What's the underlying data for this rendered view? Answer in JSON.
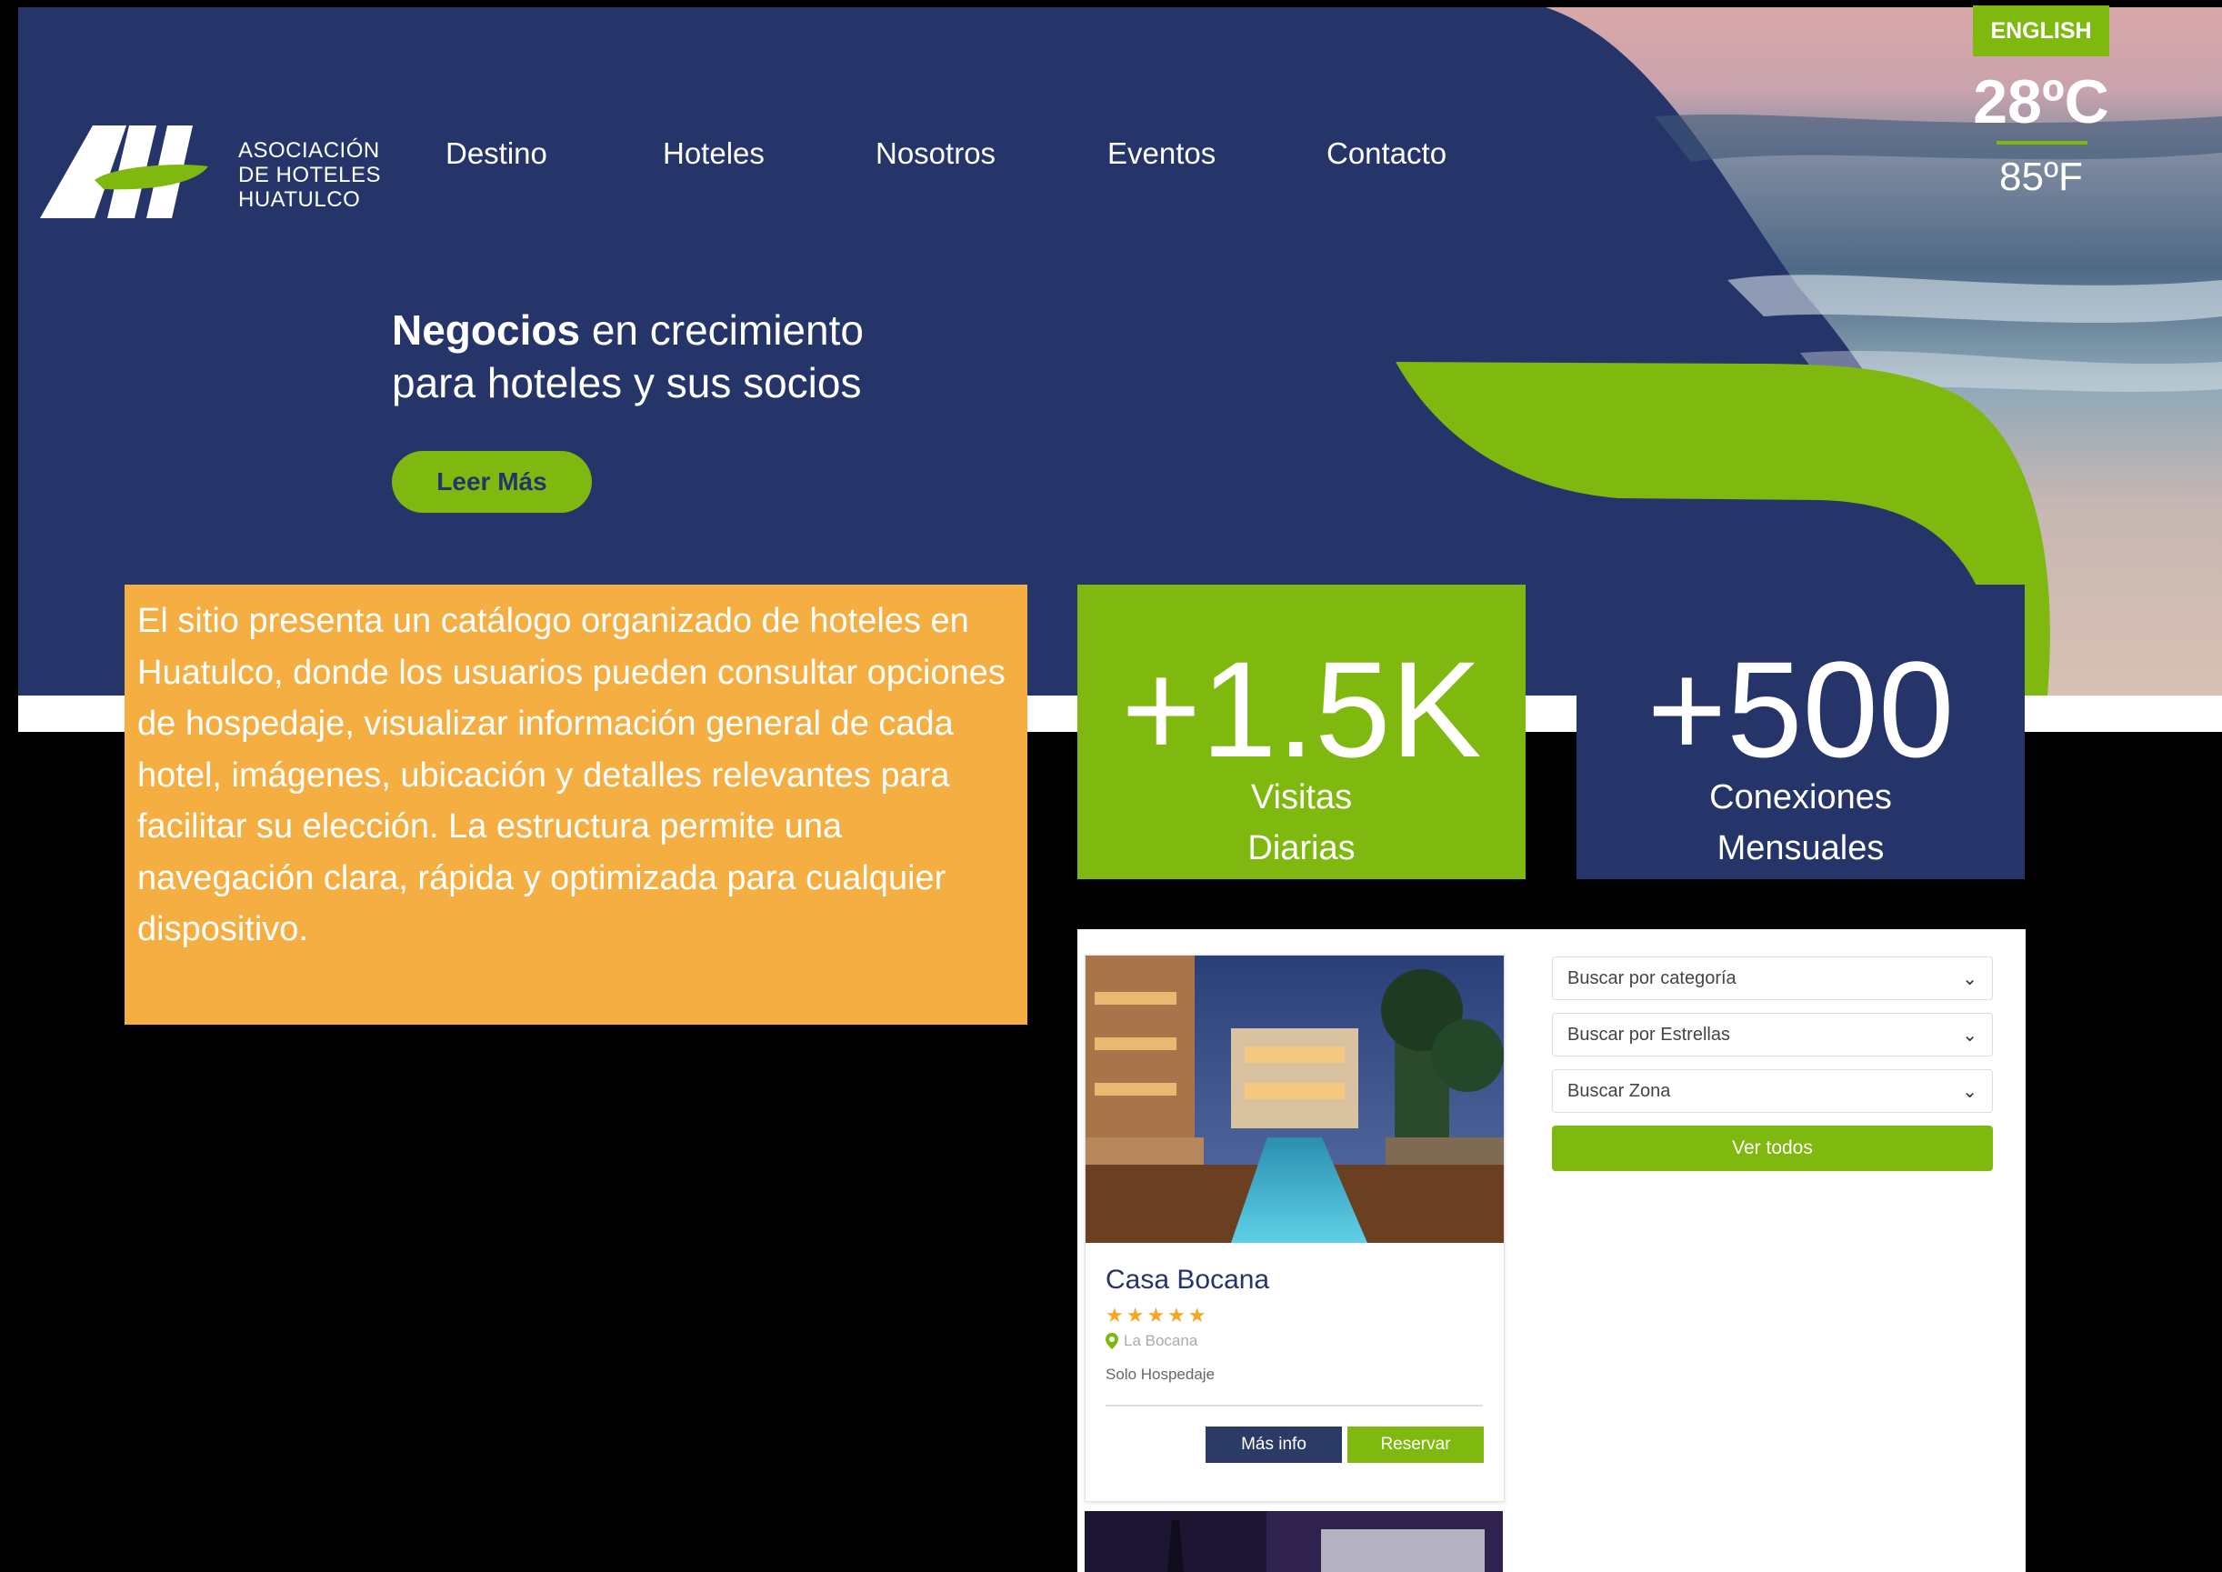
{
  "header": {
    "logo_lines": [
      "ASOCIACIÓN",
      "DE HOTELES",
      "HUATULCO"
    ],
    "nav": [
      "Destino",
      "Hoteles",
      "Nosotros",
      "Eventos",
      "Contacto"
    ],
    "language_button": "ENGLISH",
    "temp_c": "28ºC",
    "temp_f": "85ºF"
  },
  "hero": {
    "tagline_bold": "Negocios",
    "tagline_rest": " en crecimiento",
    "tagline_line2": "para hoteles y sus socios",
    "cta_label": "Leer Más"
  },
  "description": "El sitio presenta un catálogo organizado de hoteles en Huatulco, donde los usuarios pueden consultar opciones de hospedaje, visualizar información general de cada hotel, imágenes, ubicación y detalles relevantes para facilitar su elección. La estructura permite una navegación clara, rápida y optimizada para cualquier dispositivo.",
  "stats": [
    {
      "value": "+1.5K",
      "label_line1": "Visitas",
      "label_line2": "Diarias"
    },
    {
      "value": "+500",
      "label_line1": "Conexiones",
      "label_line2": "Mensuales"
    }
  ],
  "listing": {
    "card": {
      "title": "Casa Bocana",
      "stars": "★★★★★",
      "rating": 5,
      "location": "La Bocana",
      "type": "Solo Hospedaje",
      "info_button": "Más info",
      "reserve_button": "Reservar"
    },
    "filters": [
      "Buscar por categoría",
      "Buscar por Estrellas",
      "Buscar Zona"
    ],
    "view_all": "Ver todos"
  },
  "colors": {
    "navy": "#253469",
    "green": "#7fb80e",
    "orange": "#f4ae41"
  }
}
